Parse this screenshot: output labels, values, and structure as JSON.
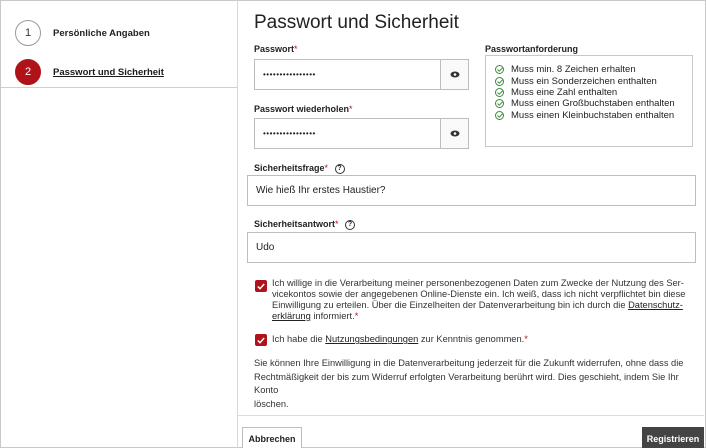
{
  "sidebar": {
    "steps": [
      {
        "number": "1",
        "label": "Persönliche Angaben"
      },
      {
        "number": "2",
        "label": "Passwort und Sicherheit"
      }
    ]
  },
  "main": {
    "title": "Passwort und Sicherheit",
    "password": {
      "label": "Passwort",
      "required_mark": "*",
      "value": "••••••••••••••••"
    },
    "password_repeat": {
      "label": "Passwort wiederholen",
      "required_mark": "*",
      "value": "••••••••••••••••"
    },
    "requirements": {
      "title": "Passwortanforderung",
      "items": [
        "Muss min. 8 Zeichen erhalten",
        "Muss ein Sonderzeichen enthalten",
        "Muss eine Zahl enthalten",
        "Muss einen Großbuchstaben enthalten",
        "Muss einen Kleinbuchstaben enthalten"
      ]
    },
    "security_question": {
      "label": "Sicherheitsfrage",
      "required_mark": "*",
      "value": "Wie hieß Ihr erstes Haustier?"
    },
    "security_answer": {
      "label": "Sicherheitsantwort",
      "required_mark": "*",
      "value": "Udo"
    },
    "info_glyph": "?",
    "consent_1": {
      "line1": "Ich willige in die Verarbeitung meiner personenbezogenen Daten zum Zwecke der Nutzung des Ser-",
      "line2": "vicekontos sowie der angegebenen Online-Dienste ein. Ich weiß, dass ich nicht verpflichtet bin diese",
      "line3_pre": "Einwilligung zu erteilen. Über die Einzelheiten der Datenverarbeitung bin ich durch die ",
      "line3_link": "Datenschutz-",
      "line4_link": "erklärung",
      "line4_post": " informiert.",
      "required_mark": "*"
    },
    "consent_2": {
      "pre": "Ich habe die ",
      "link": "Nutzungsbedingungen",
      "post": " zur Kenntnis genommen.",
      "required_mark": "*"
    },
    "revocation_note": {
      "line1": "Sie können Ihre Einwilligung in die Datenverarbeitung jederzeit für die Zukunft widerrufen, ohne dass die",
      "line2": "Rechtmäßigkeit der bis zum Widerruf erfolgten Verarbeitung berührt wird. Dies geschieht, indem Sie Ihr Konto",
      "line3": "löschen."
    }
  },
  "buttons": {
    "cancel": "Abbrechen",
    "register": "Registrieren"
  },
  "colors": {
    "accent": "#b0121a",
    "check_green": "#3a8b3a",
    "button_dark": "#444444"
  },
  "icons": {
    "eye": "eye-icon",
    "check": "check-circle-icon",
    "info": "info-circle-icon"
  }
}
